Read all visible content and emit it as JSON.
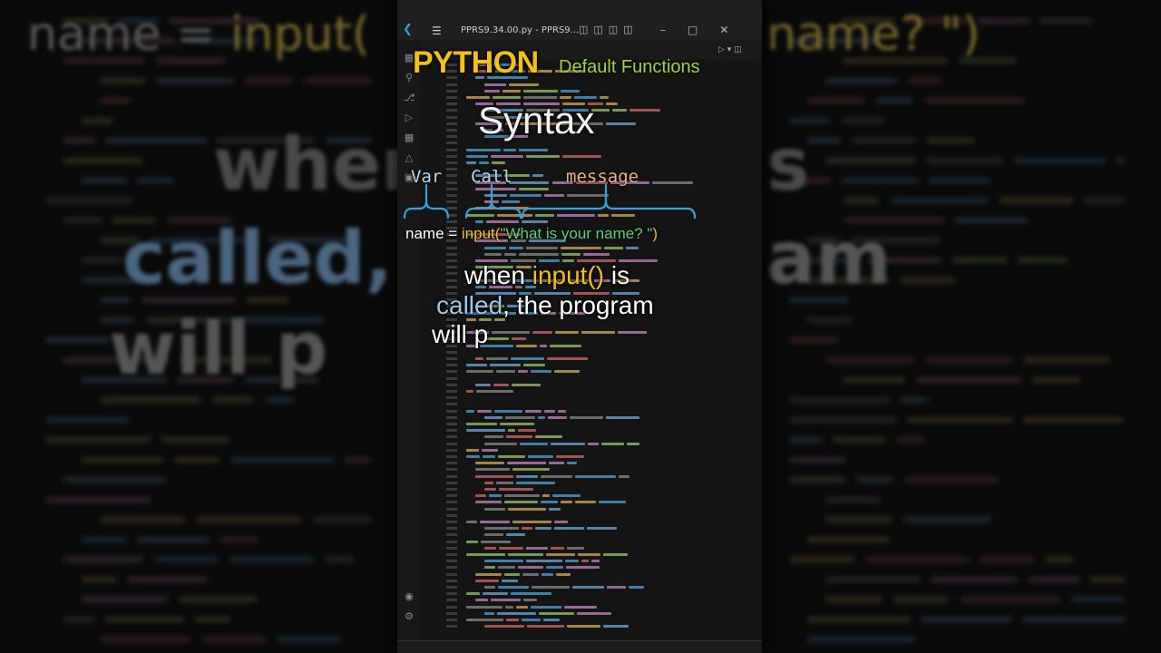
{
  "window": {
    "title": "PPRS9.34.00.py - PPRS9...",
    "menu_icon": "hamburger-icon",
    "logo_icon": "vscode-logo-icon",
    "controls": [
      "minimize-icon",
      "maximize-icon",
      "close-icon"
    ]
  },
  "heading": {
    "brand": "PYTHON",
    "subtitle": "Default Functions",
    "section": "Syntax"
  },
  "syntax_labels": {
    "var": "Var",
    "call": "Call",
    "message": "message"
  },
  "code_example": {
    "var_part": "name = ",
    "func": "input(",
    "string": "\"What is your name? \"",
    "close": ")"
  },
  "explanation": {
    "line1_a": "when ",
    "line1_b": "input()",
    "line1_c": " is",
    "line2_a": "called",
    "line2_b": ", the program",
    "line3": "will p"
  },
  "background_text": {
    "line1_a": "name = ",
    "line1_b": "input(",
    "line1_c": "name? \")",
    "line2": "when",
    "line2_right": "s",
    "line3_a": "called,",
    "line3_b": "am",
    "line4": "will p"
  },
  "colors": {
    "brand": "#f2bf1d",
    "subtitle": "#9fd24a",
    "keyword_blue": "#9fc6e6",
    "string_green": "#5fcf7a",
    "message_label": "#e8b38a",
    "label_blue": "#b9d7f0"
  }
}
